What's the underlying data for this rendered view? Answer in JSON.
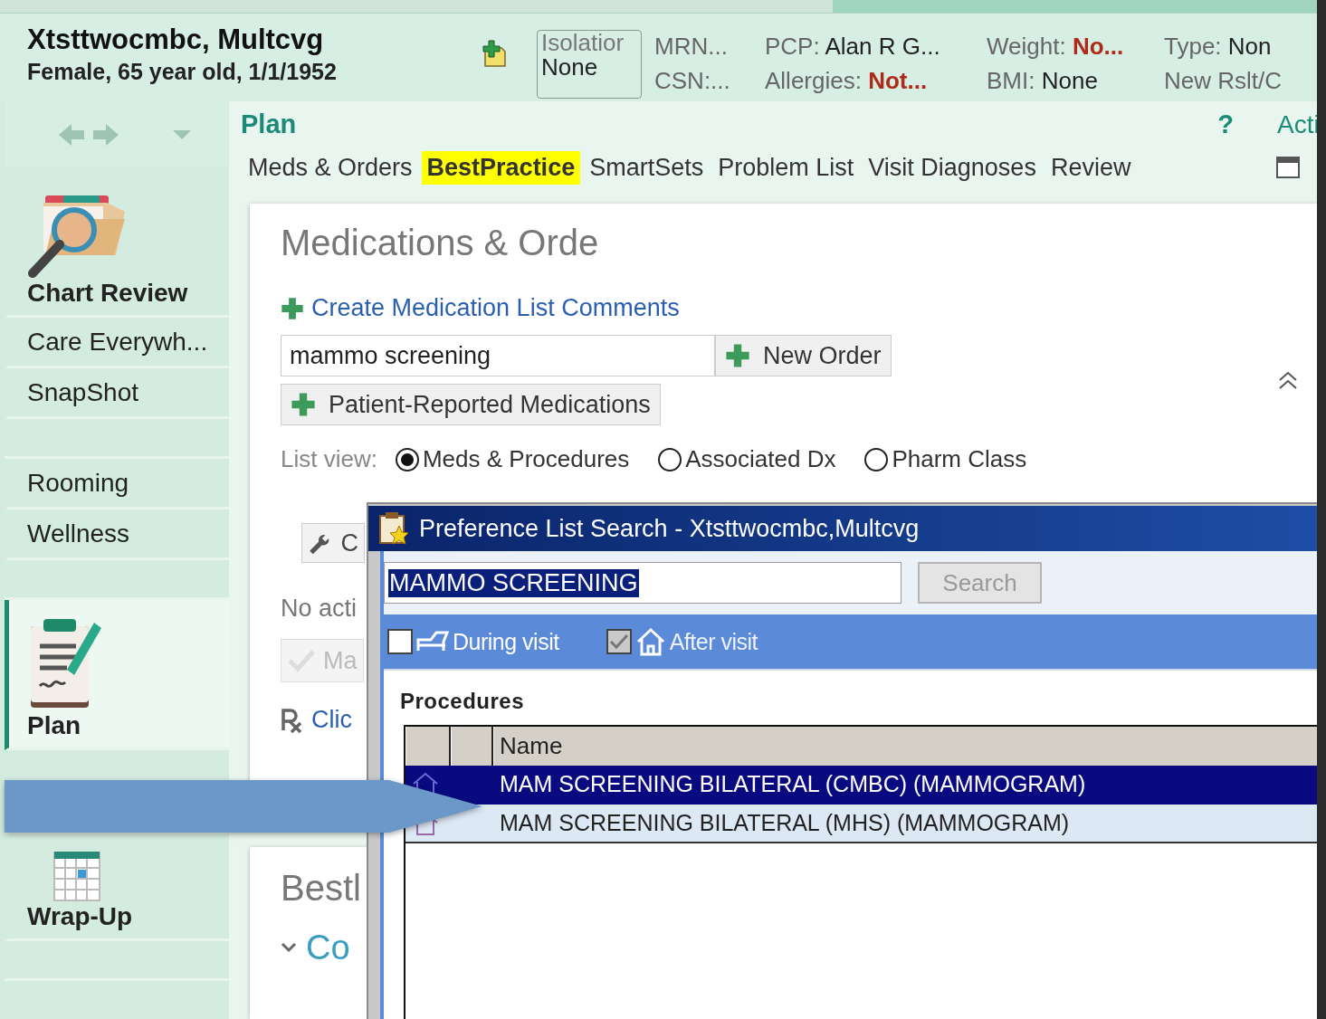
{
  "patient": {
    "name": "Xtsttwocmbc, Multcvg",
    "details": "Female, 65 year old, 1/1/1952"
  },
  "isolation": {
    "label": "Isolatior",
    "value": "None"
  },
  "header_fields": [
    [
      {
        "label": "MRN..."
      },
      {
        "label": "CSN:..."
      }
    ],
    [
      {
        "label": "PCP:",
        "value": "Alan R G...",
        "alert": false
      },
      {
        "label": "Allergies:",
        "value": "Not...",
        "alert": true
      }
    ],
    [
      {
        "label": "Weight:",
        "value": "No...",
        "alert": true
      },
      {
        "label": "BMI:",
        "value": "None",
        "alert": false
      }
    ],
    [
      {
        "label": "Type:",
        "value": "Non",
        "alert": false
      },
      {
        "label": "New Rslt/C"
      }
    ]
  ],
  "sidebar": {
    "items": [
      {
        "kind": "big",
        "label": "Chart Review",
        "selected": false
      },
      {
        "kind": "item",
        "label": "Care Everywh...",
        "selected": false
      },
      {
        "kind": "item",
        "label": "SnapShot",
        "selected": false
      },
      {
        "kind": "spacer"
      },
      {
        "kind": "item",
        "label": "Rooming",
        "selected": false
      },
      {
        "kind": "item",
        "label": "Wellness",
        "selected": false
      },
      {
        "kind": "spacer"
      },
      {
        "kind": "big",
        "label": "Plan",
        "selected": true
      },
      {
        "kind": "spacer"
      },
      {
        "kind": "big",
        "label": "Wrap-Up",
        "selected": false
      },
      {
        "kind": "spacer"
      }
    ]
  },
  "activity": {
    "title": "Plan",
    "help": "?",
    "actions": "Acti"
  },
  "tabs": [
    {
      "label": "Meds & Orders",
      "selected": false
    },
    {
      "label": "BestPractice",
      "selected": true
    },
    {
      "label": "SmartSets",
      "selected": false
    },
    {
      "label": "Problem List",
      "selected": false
    },
    {
      "label": "Visit Diagnoses",
      "selected": false
    },
    {
      "label": "Review",
      "selected": false
    }
  ],
  "meds_card": {
    "title": "Medications & Orde",
    "comment_link": "Create Medication List Comments",
    "search_value": "mammo screening",
    "new_order": "New Order",
    "patient_reported": "Patient-Reported Medications",
    "list_view": {
      "label": "List view:",
      "options": [
        {
          "label": "Meds & Procedures",
          "selected": true
        },
        {
          "label": "Associated Dx",
          "selected": false
        },
        {
          "label": "Pharm Class",
          "selected": false
        }
      ]
    },
    "tool_button": "C",
    "no_active": "No acti",
    "mark_button": "Ma",
    "rx_link": "Clic"
  },
  "bestpractice_card": {
    "title": "Bestl",
    "section": "Co"
  },
  "dialog": {
    "title": "Preference List Search - Xtsttwocmbc,Multcvg",
    "search_value": "MAMMO SCREENING",
    "search_button": "Search",
    "filters": [
      {
        "label": "During visit",
        "checked": false,
        "disabled": false
      },
      {
        "label": "After visit",
        "checked": true,
        "disabled": true
      }
    ],
    "section": "Procedures",
    "columns": [
      "Name"
    ],
    "rows": [
      {
        "name": "MAM SCREENING BILATERAL (CMBC) (MAMMOGRAM)",
        "selected": true
      },
      {
        "name": "MAM SCREENING BILATERAL (MHS) (MAMMOGRAM)",
        "selected": false
      }
    ]
  }
}
